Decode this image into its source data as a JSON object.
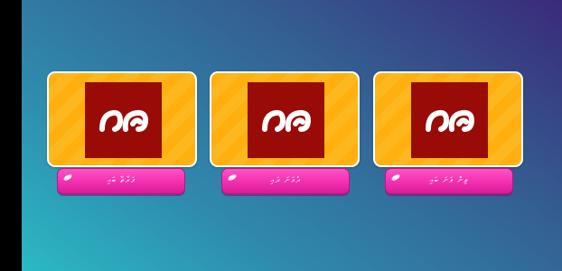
{
  "colors": {
    "background_start": "#2bb9c4",
    "background_end": "#3a2a7a",
    "card_orange": "#ffb00e",
    "tile_red": "#980b06",
    "button_pink": "#f12fb0"
  },
  "cards": [
    {
      "icon": "thaana-glyph-icon",
      "glyph": "ރަރ",
      "button_label": "ފަރާތާ ބައި"
    },
    {
      "icon": "thaana-glyph-icon",
      "glyph": "ރަރ",
      "button_label": "ދެވަނަ ދައި"
    },
    {
      "icon": "thaana-glyph-icon",
      "glyph": "ރަރ",
      "button_label": "ތިން ވަނަ ބައި"
    }
  ]
}
